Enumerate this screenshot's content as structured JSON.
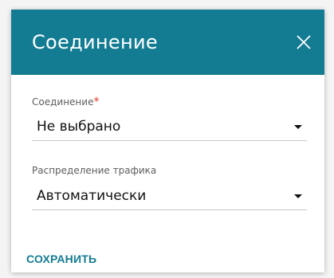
{
  "dialog": {
    "title": "Соединение",
    "close_icon": "close-icon",
    "accent_color": "#137c93"
  },
  "fields": {
    "connection": {
      "label": "Соединение",
      "required_mark": "*",
      "value": "Не выбрано"
    },
    "traffic": {
      "label": "Распределение трафика",
      "value": "Автоматически"
    }
  },
  "actions": {
    "save_label": "СОХРАНИТЬ"
  }
}
